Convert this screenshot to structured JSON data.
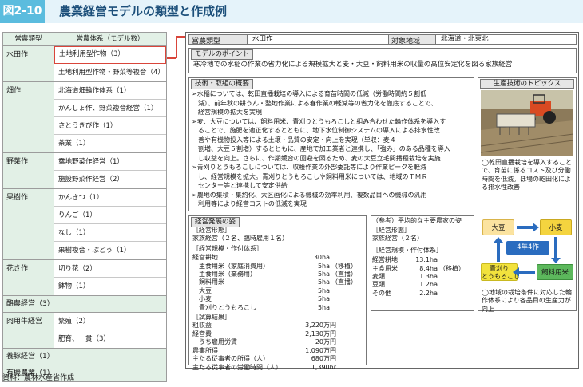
{
  "header": {
    "number": "図2-10",
    "title": "農業経営モデルの類型と作成例"
  },
  "left_table": {
    "col1": "営農類型",
    "col2": "営農体系（モデル数）",
    "groups": [
      {
        "name": "水田作",
        "items": [
          "土地利用型作物（3）",
          "土地利用型作物・野菜等複合（4）"
        ]
      },
      {
        "name": "畑作",
        "items": [
          "北海道畑輪作体系（1）",
          "かんしょ作、野菜複合経営（1）",
          "さとうきび作（1）",
          "茶業（1）"
        ]
      },
      {
        "name": "野菜作",
        "items": [
          "露地野菜作経営（1）",
          "施設野菜作経営（2）"
        ]
      },
      {
        "name": "果樹作",
        "items": [
          "かんきつ（1）",
          "りんご（1）",
          "なし（1）",
          "果樹複合・ぶどう（1）"
        ]
      },
      {
        "name": "花き作",
        "items": [
          "切り花（2）",
          "鉢物（1）"
        ]
      },
      {
        "name": "酪農経営（3）",
        "items": []
      },
      {
        "name": "肉用牛経営",
        "items": [
          "繁殖（2）",
          "肥育、一貫（3）"
        ]
      },
      {
        "name": "養豚経営（1）",
        "items": []
      },
      {
        "name": "有機農業（1）",
        "items": []
      }
    ]
  },
  "source": "資料：農林水産省作成",
  "detail": {
    "type_label": "営農類型",
    "type_value": "水田作",
    "region_label": "対象地域",
    "region_value": "北海道・北東北",
    "point_title": "モデルのポイント",
    "point_text": "寒冷地での水稲の作業の省力化による規模拡大と麦・大豆・飼料用米の収量の高位安定化を図る家族経営",
    "tech_title": "技術・取組の概要",
    "tech_lines": [
      "➢水稲については、乾田直播栽培の導入による育苗時間の低減（労働時間約５割低",
      "　減）、前年秋の耕うん・整地作業による春作業の軽減等の省力化を徹底することで、",
      "　経営規模の拡大を実現",
      "➢麦、大豆については、飼料用米、青刈りとうもろこしと組み合わせた輪作体系を導入す",
      "　ることで、施肥を適正化するとともに、地下水位制御システムの導入による排水性改",
      "　善や有機物投入等による土壌・品質の安定・向上を実現（単収：麦４",
      "　割増、大豆５割増）するとともに、産地で加工業者と連携し、「強み」のある品種を導入",
      "　し収益を向上。さらに、作期競合の回避を図るため、麦の大豆立毛間播種栽培を実施",
      "➢青刈りとうもろこしについては、収穫作業の外部委託等により作業ピークを軽減",
      "　し、経営規模を拡大。青刈りとうもろこしや飼料用米については、地域のＴＭＲ",
      "　センター等と連携して安定供給",
      "➢農地の集積・集約化、大区画化による機械の効率利用、複数品目への機械の汎用",
      "　利用等により経営コストの低減を実現"
    ],
    "topics_title": "生産技術のトピックス",
    "photo_caption": "◯乾田直播栽培を導入することで、育苗に係るコスト及び分働時間を低減。ほ場の乾田化による排水性改善",
    "cycle": {
      "soy": "大豆",
      "wheat": "小麦",
      "center": "4年4作",
      "corn": "青刈り\nとうもろこし",
      "rice": "飼料用米"
    },
    "bottom_caption": "◯地域の栽培条件に対応した輪作体系により各品目の生産力が向上",
    "model_title": "経営発展の姿",
    "model_form_h": "［経営形態］",
    "model_form": "家族経営（２名、臨時雇用１名）",
    "model_scale_h": "［経営規模・作付体系］",
    "model_rows": [
      {
        "k": "経営耕地",
        "v": "30ha",
        "n": ""
      },
      {
        "k": "　主食用米（家庭消費用）",
        "v": "5ha",
        "n": "（移植）"
      },
      {
        "k": "　主食用米（業務用）",
        "v": "5ha",
        "n": "（直播）"
      },
      {
        "k": "　飼料用米",
        "v": "5ha",
        "n": "（直播）"
      },
      {
        "k": "　大豆",
        "v": "5ha",
        "n": ""
      },
      {
        "k": "　小麦",
        "v": "5ha",
        "n": ""
      },
      {
        "k": "　青刈りとうもろこし",
        "v": "5ha",
        "n": ""
      }
    ],
    "model_result_h": "［試算結果］",
    "model_results": [
      {
        "k": "粗収益",
        "v": "3,220万円"
      },
      {
        "k": "経営費",
        "v": "2,130万円"
      },
      {
        "k": "　うち雇用労賃",
        "v": "20万円"
      },
      {
        "k": "農業所得",
        "v": "1,090万円"
      },
      {
        "k": "主たる従事者の所得（人）",
        "v": "680万円"
      },
      {
        "k": "主たる従事者の労働時間（人）",
        "v": "1,390hr"
      }
    ],
    "avg_title": "（参考）平均的な主要農家の姿",
    "avg_form_h": "［経営形態］",
    "avg_form": "家族経営（２名）",
    "avg_scale_h": "［経営規模・作付体系］",
    "avg_rows": [
      {
        "k": "経営耕地",
        "v": "13.1ha",
        "n": ""
      },
      {
        "k": "主食用米",
        "v": "8.4ha",
        "n": "（移植）"
      },
      {
        "k": "麦類",
        "v": "1.3ha",
        "n": ""
      },
      {
        "k": "豆類",
        "v": "1.2ha",
        "n": ""
      },
      {
        "k": "その他",
        "v": "2.2ha",
        "n": ""
      }
    ]
  },
  "colors": {
    "accent": "#5bbcde",
    "header_bg": "#e5f3fa",
    "green_bg": "#e2f0e6",
    "highlight": "#d9453a",
    "soy": "#fbe3a0",
    "wheat": "#f4d43f",
    "center": "#2a6cbf",
    "corn": "#f2e23d",
    "rice": "#5cb85c"
  }
}
